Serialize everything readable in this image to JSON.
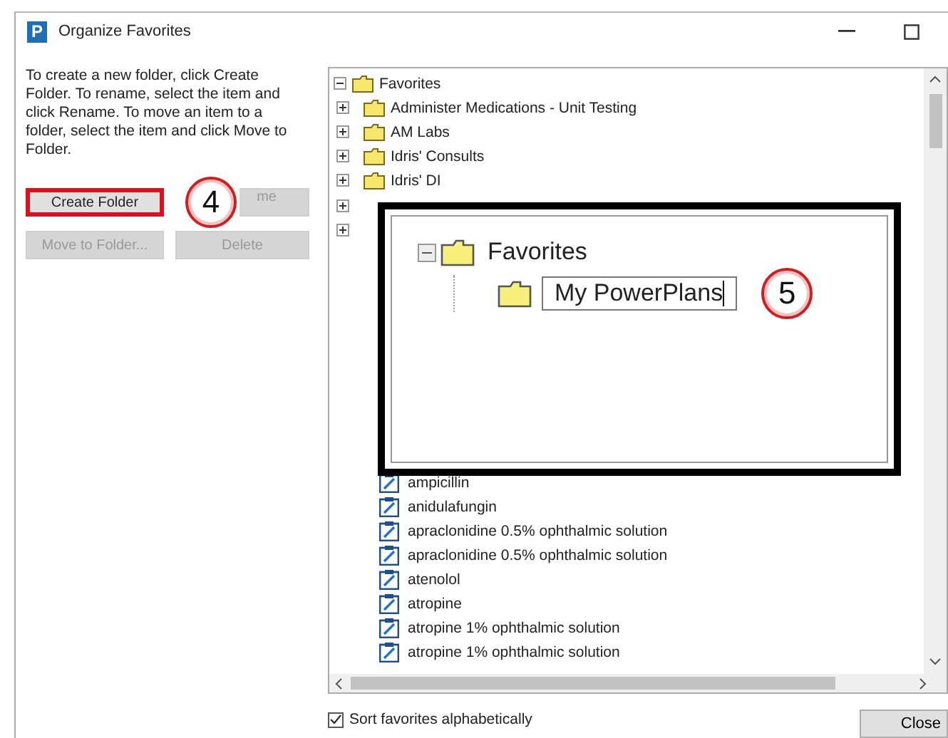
{
  "window": {
    "icon_letter": "P",
    "title": "Organize Favorites"
  },
  "instructions": "To create a new folder, click Create Folder. To rename, select the item and click Rename. To move an item to a folder, select the item and click Move to Folder.",
  "buttons": [
    {
      "label": "Create Folder",
      "disabled": false,
      "highlighted": true
    },
    {
      "label": "me",
      "disabled": true,
      "highlighted": false
    },
    {
      "label": "Move to Folder...",
      "disabled": true,
      "highlighted": false
    },
    {
      "label": "Delete",
      "disabled": true,
      "highlighted": false
    }
  ],
  "step_badges": [
    "4",
    "5"
  ],
  "tree": {
    "root": {
      "label": "Favorites",
      "expanded": true
    },
    "items": [
      {
        "kind": "folder",
        "label": "Administer Medications - Unit Testing",
        "expanded": false
      },
      {
        "kind": "folder",
        "label": "AM Labs",
        "expanded": false
      },
      {
        "kind": "folder",
        "label": "Idris' Consults",
        "expanded": false
      },
      {
        "kind": "folder",
        "label": "Idris' DI",
        "expanded": false
      }
    ],
    "plans": [
      {
        "kind": "plan",
        "label": "ampicillin"
      },
      {
        "kind": "plan",
        "label": "anidulafungin"
      },
      {
        "kind": "plan",
        "label": "apraclonidine 0.5% ophthalmic solution"
      },
      {
        "kind": "plan",
        "label": "apraclonidine 0.5% ophthalmic solution"
      },
      {
        "kind": "plan",
        "label": "atenolol"
      },
      {
        "kind": "plan",
        "label": "atropine"
      },
      {
        "kind": "plan",
        "label": "atropine 1% ophthalmic solution"
      },
      {
        "kind": "plan",
        "label": "atropine 1% ophthalmic solution"
      }
    ]
  },
  "inset": {
    "root": {
      "label": "Favorites",
      "expanded": true
    },
    "new_folder": {
      "value": "My PowerPlans"
    }
  },
  "sort_checkbox": {
    "label": "Sort favorites alphabetically",
    "checked": true
  },
  "close_button": {
    "label": "Close"
  }
}
